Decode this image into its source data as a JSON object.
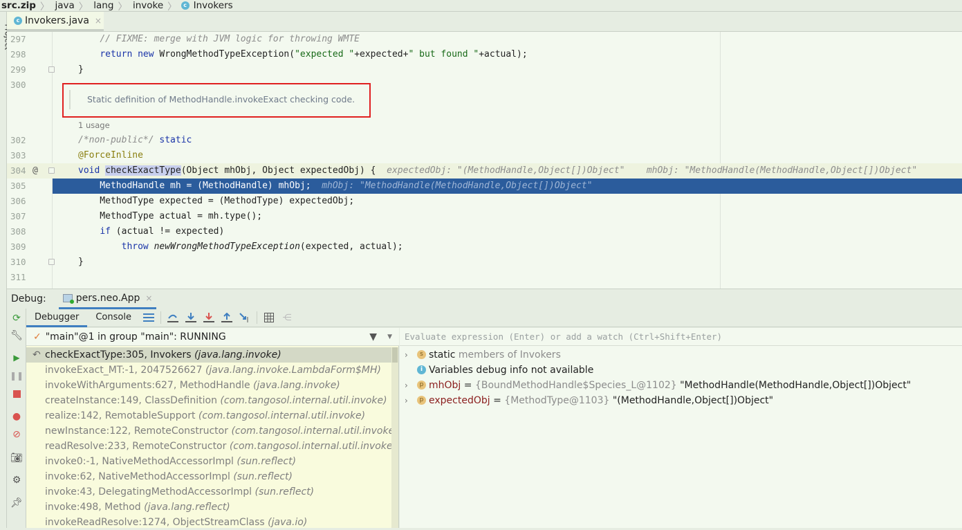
{
  "breadcrumb": [
    "src.zip",
    "java",
    "lang",
    "invoke",
    "Invokers"
  ],
  "left_strip_label": "Project",
  "file_tab": {
    "label": "Invokers.java",
    "close": "×"
  },
  "editor": {
    "doc_comment": "Static definition of MethodHandle.invokeExact checking code.",
    "usage_hint": "1 usage",
    "lines": [
      {
        "num": "297",
        "segs": [
          [
            "    ",
            ""
          ],
          [
            "// FIXME: merge with JVM logic for throwing WMTE",
            "cm"
          ]
        ]
      },
      {
        "num": "298",
        "segs": [
          [
            "    ",
            ""
          ],
          [
            "return new",
            "kw"
          ],
          [
            " WrongMethodTypeException(",
            ""
          ],
          [
            "\"expected \"",
            "st"
          ],
          [
            "+expected+",
            ""
          ],
          [
            "\" but found \"",
            "st"
          ],
          [
            "+actual);",
            ""
          ]
        ]
      },
      {
        "num": "299",
        "segs": [
          [
            "}",
            ""
          ]
        ],
        "fold": true
      },
      {
        "num": "300",
        "segs": []
      },
      {
        "num": "302",
        "segs": [
          [
            "/*non-public*/",
            "cm"
          ],
          [
            " ",
            ""
          ],
          [
            "static",
            "kw"
          ]
        ]
      },
      {
        "num": "303",
        "segs": [
          [
            "@ForceInline",
            "an"
          ]
        ]
      },
      {
        "num": "304",
        "segs": [
          [
            "void",
            "kw"
          ],
          [
            " ",
            ""
          ],
          [
            "checkExactType",
            "fn"
          ],
          [
            "(Object mhObj, Object expectedObj) {",
            ""
          ],
          [
            "  expectedObj: \"(MethodHandle,Object[])Object\"    mhObj: \"MethodHandle(MethodHandle,Object[])Object\"",
            "hint"
          ]
        ],
        "fold": true,
        "at": "@",
        "current": true
      },
      {
        "num": "305",
        "segs": [
          [
            "    MethodHandle mh = (MethodHandle) mhObj;",
            ""
          ],
          [
            "  mhObj: \"MethodHandle(MethodHandle,Object[])Object\"",
            "hint"
          ]
        ],
        "exec": true
      },
      {
        "num": "306",
        "segs": [
          [
            "    MethodType expected = (MethodType) expectedObj;",
            ""
          ]
        ]
      },
      {
        "num": "307",
        "segs": [
          [
            "    MethodType actual = mh.type();",
            ""
          ]
        ]
      },
      {
        "num": "308",
        "segs": [
          [
            "    ",
            ""
          ],
          [
            "if",
            "kw"
          ],
          [
            " (actual != expected)",
            ""
          ]
        ]
      },
      {
        "num": "309",
        "segs": [
          [
            "        ",
            ""
          ],
          [
            "throw",
            "kw"
          ],
          [
            " ",
            ""
          ],
          [
            "newWrongMethodTypeException",
            "it"
          ],
          [
            "(expected, actual);",
            ""
          ]
        ]
      },
      {
        "num": "310",
        "segs": [
          [
            "}",
            ""
          ]
        ],
        "fold": true
      },
      {
        "num": "311",
        "segs": []
      }
    ]
  },
  "debug": {
    "label": "Debug:",
    "run_tab": "pers.neo.App",
    "close": "×",
    "tabs": [
      "Debugger",
      "Console"
    ],
    "thread": "\"main\"@1 in group \"main\": RUNNING",
    "eval_placeholder": "Evaluate expression (Enter) or add a watch (Ctrl+Shift+Enter)",
    "frames": [
      {
        "method": "checkExactType:305, Invokers ",
        "pkg": "(java.lang.invoke)"
      },
      {
        "method": "invokeExact_MT:-1, 2047526627 ",
        "pkg": "(java.lang.invoke.LambdaForm$MH)"
      },
      {
        "method": "invokeWithArguments:627, MethodHandle ",
        "pkg": "(java.lang.invoke)"
      },
      {
        "method": "createInstance:149, ClassDefinition ",
        "pkg": "(com.tangosol.internal.util.invoke)"
      },
      {
        "method": "realize:142, RemotableSupport ",
        "pkg": "(com.tangosol.internal.util.invoke)"
      },
      {
        "method": "newInstance:122, RemoteConstructor ",
        "pkg": "(com.tangosol.internal.util.invoke)"
      },
      {
        "method": "readResolve:233, RemoteConstructor ",
        "pkg": "(com.tangosol.internal.util.invoke)"
      },
      {
        "method": "invoke0:-1, NativeMethodAccessorImpl ",
        "pkg": "(sun.reflect)"
      },
      {
        "method": "invoke:62, NativeMethodAccessorImpl ",
        "pkg": "(sun.reflect)"
      },
      {
        "method": "invoke:43, DelegatingMethodAccessorImpl ",
        "pkg": "(sun.reflect)"
      },
      {
        "method": "invoke:498, Method ",
        "pkg": "(java.lang.reflect)"
      },
      {
        "method": "invokeReadResolve:1274, ObjectStreamClass ",
        "pkg": "(java.io)"
      }
    ],
    "variables": [
      {
        "expand": true,
        "icon": "s",
        "name": "static",
        "rest": " members of Invokers",
        "kind": "static"
      },
      {
        "expand": false,
        "icon": "i",
        "name": "Variables debug info not available",
        "kind": "info"
      },
      {
        "expand": true,
        "icon": "p",
        "name": "mhObj",
        "type": "{BoundMethodHandle$Species_L@1102}",
        "value": " \"MethodHandle(MethodHandle,Object[])Object\"",
        "kind": "var"
      },
      {
        "expand": true,
        "icon": "p",
        "name": "expectedObj",
        "type": "{MethodType@1103}",
        "value": " \"(MethodHandle,Object[])Object\"",
        "kind": "var"
      }
    ]
  },
  "colors": {
    "accent": "#3f7fc0",
    "exec_line": "#2b5c9c",
    "highlight_box": "#e02020"
  }
}
